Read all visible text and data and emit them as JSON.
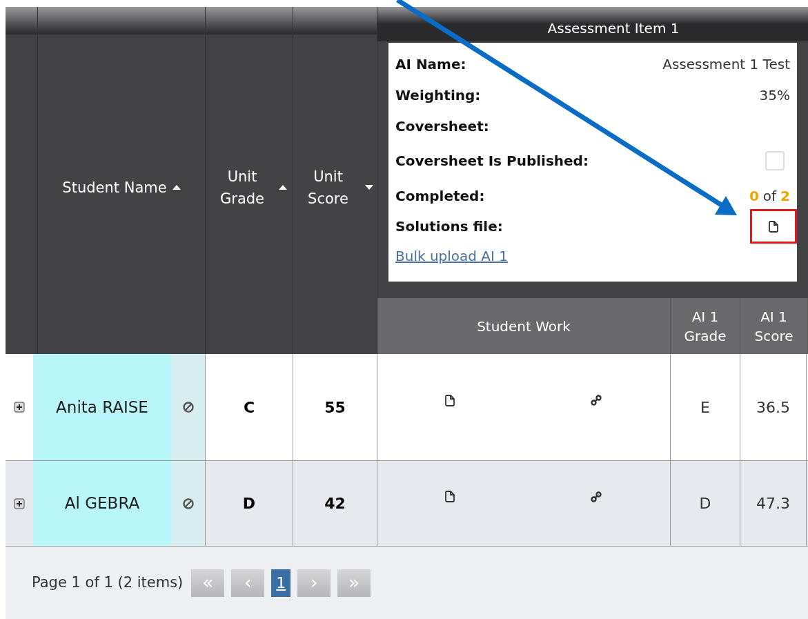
{
  "columns": [
    {
      "label": "Student Name",
      "descending": false
    },
    {
      "label": "Unit Grade",
      "descending": false
    },
    {
      "label": "Unit Score",
      "descending": true
    }
  ],
  "assessment": {
    "title": "Assessment Item 1",
    "fields": [
      {
        "kind": "text",
        "label": "AI Name:",
        "value": "Assessment 1 Test"
      },
      {
        "kind": "text",
        "label": "Weighting:",
        "value": "35%"
      },
      {
        "kind": "text",
        "label": "Coversheet:"
      },
      {
        "kind": "checkbox",
        "label": "Coversheet Is Published:",
        "checked": false
      },
      {
        "kind": "progress",
        "label": "Completed:",
        "done": "0",
        "of": "of",
        "total": "2"
      },
      {
        "kind": "file",
        "label": "Solutions file:",
        "highlighted": true
      }
    ],
    "link": "Bulk upload AI 1",
    "sub_columns": [
      "Student Work",
      "AI 1 Grade",
      "AI 1 Score"
    ]
  },
  "rows": [
    {
      "name": "Anita RAISE",
      "highlighted": true,
      "unit_grade": "C",
      "unit_score": "55",
      "ai_grade": "E",
      "ai_score": "36.5"
    },
    {
      "name": "Al GEBRA",
      "highlighted": true,
      "unit_grade": "D",
      "unit_score": "42",
      "ai_grade": "D",
      "ai_score": "47.3"
    }
  ],
  "pager": {
    "summary": "Page 1 of 1 (2 items)",
    "buttons": [
      {
        "label": "«",
        "selected": false
      },
      {
        "label": "‹",
        "selected": false
      },
      {
        "label": "1",
        "selected": true
      },
      {
        "label": "›",
        "selected": false
      },
      {
        "label": "»",
        "selected": false
      }
    ]
  }
}
